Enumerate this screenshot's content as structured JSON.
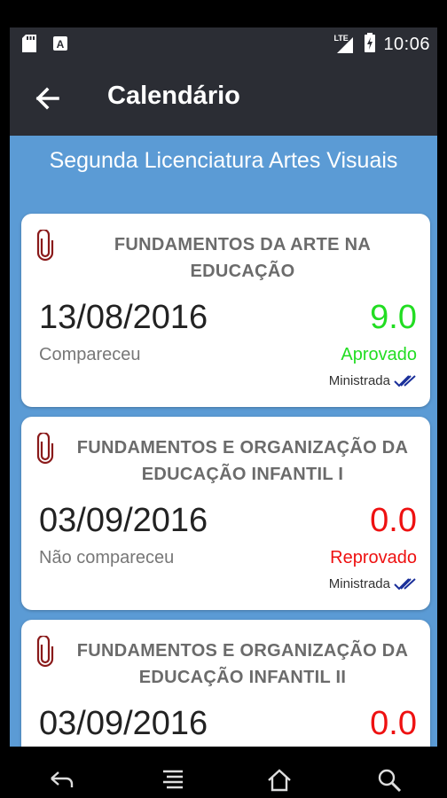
{
  "status_bar": {
    "time": "10:06",
    "network": "LTE",
    "icons": [
      "sd-card-icon",
      "a-notification-icon",
      "signal-icon",
      "battery-icon"
    ]
  },
  "app_bar": {
    "title": "Calendário",
    "back_icon": "arrow-left-icon"
  },
  "subtitle": "Segunda Licenciatura Artes Visuais",
  "colors": {
    "bar": "#2b2d34",
    "content_bg": "#5b9bd5",
    "approved": "#22dd22",
    "failed": "#ee1111",
    "clip": "#8a1a1a",
    "check": "#1a2f9a"
  },
  "cards": [
    {
      "title": "FUNDAMENTOS DA ARTE NA EDUCAÇÃO",
      "date": "13/08/2016",
      "grade": "9.0",
      "attendance": "Compareceu",
      "status": "Aprovado",
      "status_kind": "approved",
      "ministrada": "Ministrada"
    },
    {
      "title": "FUNDAMENTOS E ORGANIZAÇÃO DA EDUCAÇÃO INFANTIL I",
      "date": "03/09/2016",
      "grade": "0.0",
      "attendance": "Não compareceu",
      "status": "Reprovado",
      "status_kind": "failed",
      "ministrada": "Ministrada"
    },
    {
      "title": "FUNDAMENTOS E ORGANIZAÇÃO DA EDUCAÇÃO INFANTIL II",
      "date": "03/09/2016",
      "grade": "0.0",
      "attendance": "",
      "status": "",
      "status_kind": "failed",
      "ministrada": ""
    }
  ],
  "nav_bar": {
    "icons": [
      "nav-back-icon",
      "nav-menu-icon",
      "nav-home-icon",
      "nav-search-icon"
    ]
  }
}
